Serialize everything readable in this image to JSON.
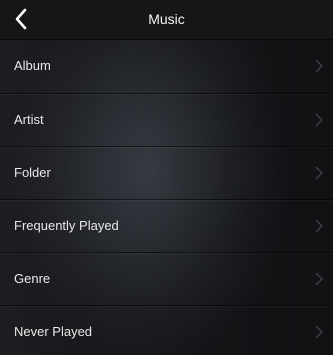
{
  "header": {
    "title": "Music"
  },
  "menu": {
    "items": [
      {
        "label": "Album",
        "icon": "chevron-right-icon"
      },
      {
        "label": "Artist",
        "icon": "chevron-right-icon"
      },
      {
        "label": "Folder",
        "icon": "chevron-right-icon"
      },
      {
        "label": "Frequently Played",
        "icon": "chevron-right-icon"
      },
      {
        "label": "Genre",
        "icon": "chevron-right-icon"
      },
      {
        "label": "Never Played",
        "icon": "chevron-right-icon"
      }
    ]
  },
  "colors": {
    "titlebar_bg": "#151618",
    "text": "#e9e9e9",
    "chevron": "#3c3f44"
  }
}
